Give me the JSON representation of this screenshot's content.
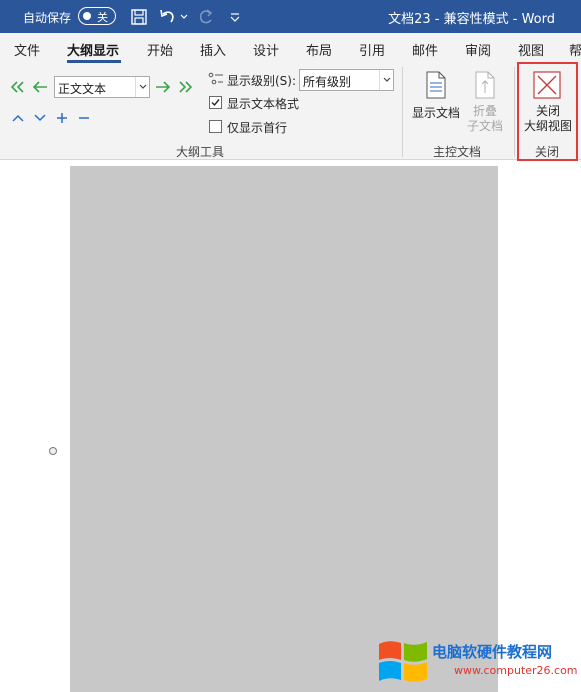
{
  "titlebar": {
    "autosave_label": "自动保存",
    "autosave_state": "关",
    "document_title": "文档23  -  兼容性模式  -  Word",
    "background_color": "#2b579a",
    "icons": [
      "save-icon",
      "undo-icon",
      "redo-icon",
      "customize-quick-access-icon"
    ]
  },
  "tabs": [
    {
      "label": "文件"
    },
    {
      "label": "大纲显示",
      "active": true
    },
    {
      "label": "开始"
    },
    {
      "label": "插入"
    },
    {
      "label": "设计"
    },
    {
      "label": "布局"
    },
    {
      "label": "引用"
    },
    {
      "label": "邮件"
    },
    {
      "label": "审阅"
    },
    {
      "label": "视图"
    },
    {
      "label": "帮"
    }
  ],
  "outline_tools": {
    "group_label": "大纲工具",
    "level_value": "正文文本",
    "show_level_label": "显示级别(S):",
    "show_level_value": "所有级别",
    "show_text_formatting_label": "显示文本格式",
    "show_text_formatting_checked": true,
    "show_first_line_only_label": "仅显示首行",
    "show_first_line_only_checked": false,
    "icons": [
      "promote-to-heading1-icon",
      "promote-icon",
      "demote-icon",
      "demote-to-body-text-icon",
      "move-up-icon",
      "move-down-icon",
      "expand-icon",
      "collapse-icon"
    ]
  },
  "master_document": {
    "group_label": "主控文档",
    "show_document_label": "显示文档",
    "collapse_subdocuments_label_1": "折叠",
    "collapse_subdocuments_label_2": "子文档"
  },
  "close_group": {
    "group_label": "关闭",
    "close_outline_label_1": "关闭",
    "close_outline_label_2": "大纲视图",
    "highlight_color": "#e03c3c"
  },
  "watermark": {
    "site_name": "电脑软硬件教程网",
    "url": "www.computer26.com"
  }
}
